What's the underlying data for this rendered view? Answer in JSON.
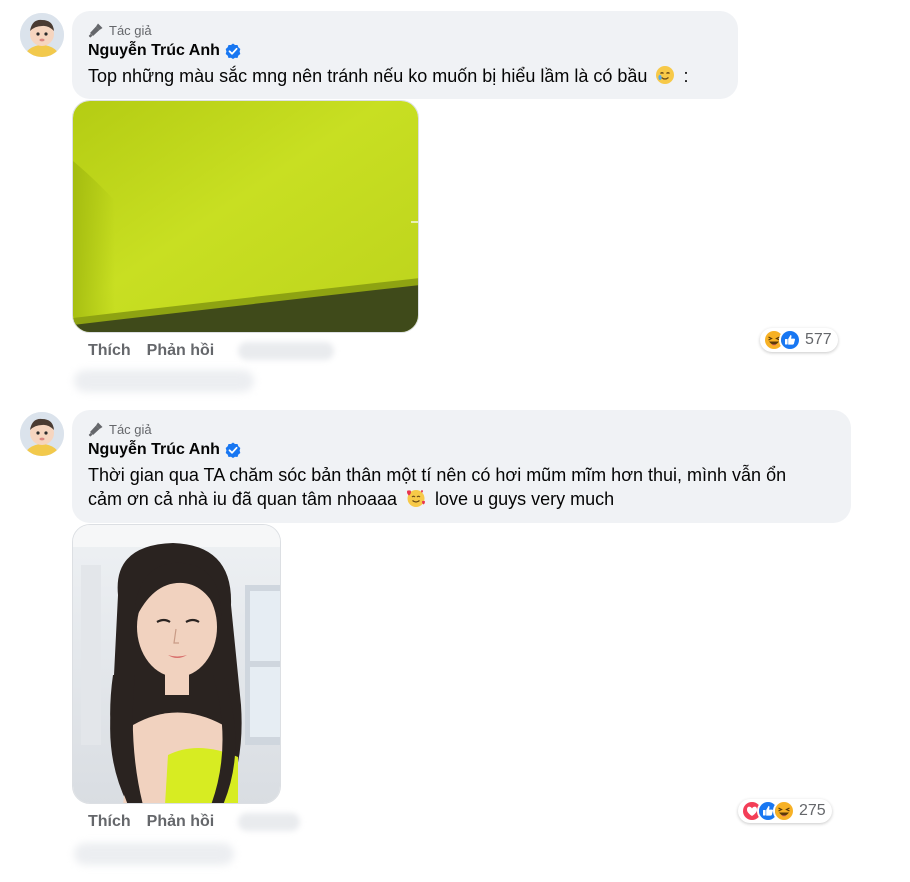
{
  "comments": [
    {
      "badge": "Tác giả",
      "author": "Nguyễn Trúc Anh",
      "text_main": "Top những màu sắc mng nên tránh nếu ko muốn bị hiểu lầm là có bầu",
      "text_tail": ":",
      "emoji_icon": "crying-smile-emoji",
      "like_label": "Thích",
      "reply_label": "Phản hồi",
      "reaction_icons": [
        "haha-icon",
        "like-icon"
      ],
      "reaction_count": "577"
    },
    {
      "badge": "Tác giả",
      "author": "Nguyễn Trúc Anh",
      "text_line1": "Thời gian qua TA chăm sóc bản thân một tí nên có hơi mũm mĩm hơn thui, mình vẫn ổn",
      "text_line2_before": "cảm ơn cả nhà iu đã quan tâm nhoaaa",
      "text_line2_after": "love u guys very much",
      "emoji_icon": "smiling-face-with-hearts-emoji",
      "like_label": "Thích",
      "reply_label": "Phản hồi",
      "reaction_icons": [
        "love-icon",
        "like-icon",
        "haha-icon"
      ],
      "reaction_count": "275"
    }
  ],
  "colors": {
    "bubble": "#f0f2f5",
    "secondary_text": "#65676b",
    "verified": "#1877f2",
    "fabric_green": "#c6dc1f"
  }
}
